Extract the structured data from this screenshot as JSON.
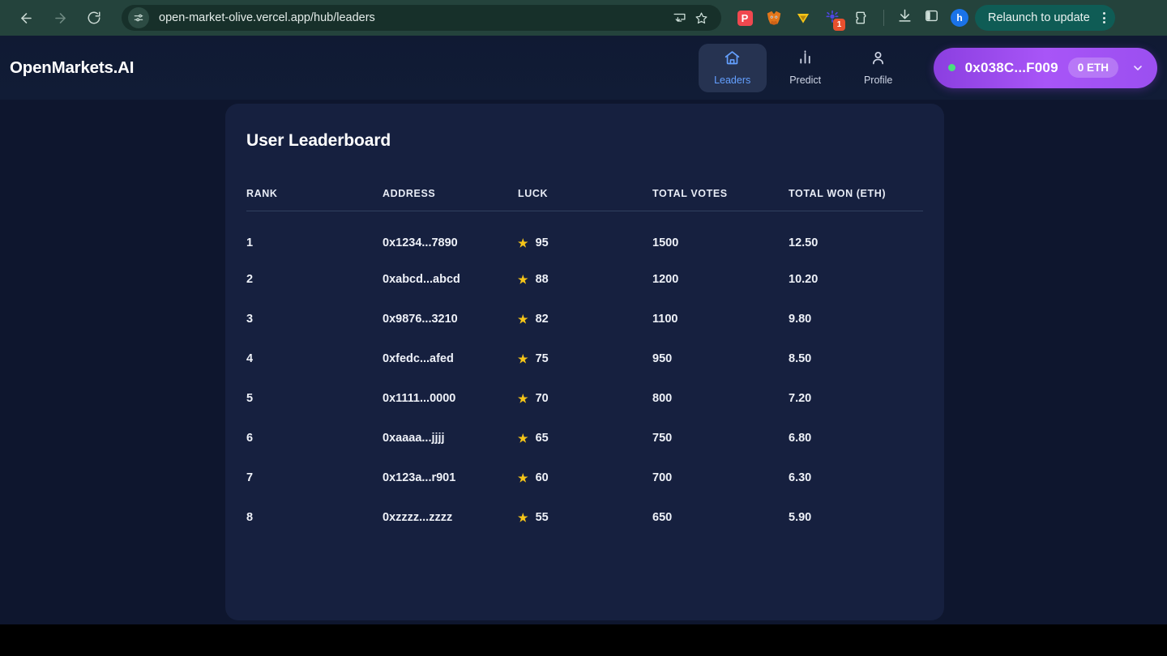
{
  "browser": {
    "back_icon": "back-arrow-icon",
    "forward_icon": "forward-arrow-icon",
    "reload_icon": "reload-icon",
    "site_info_icon": "site-settings-icon",
    "url": "open-market-olive.vercel.app/hub/leaders",
    "cast_icon": "cast-icon",
    "bookmark_icon": "star-outline-icon",
    "extensions": [
      {
        "name": "pocket-extension-icon",
        "label": "P"
      },
      {
        "name": "metamask-fox-icon",
        "label": "🦊"
      },
      {
        "name": "triangle-wallet-icon",
        "label": "▼"
      },
      {
        "name": "starburst-extension-icon",
        "badge": "1"
      },
      {
        "name": "extensions-puzzle-icon",
        "label": ""
      }
    ],
    "download_icon": "download-icon",
    "side_panel_icon": "side-panel-icon",
    "profile_initial": "h",
    "relaunch_label": "Relaunch to update",
    "menu_icon": "kebab-menu-icon"
  },
  "header": {
    "logo": "OpenMarkets.AI",
    "nav": [
      {
        "label": "Leaders",
        "icon": "home-icon",
        "active": true
      },
      {
        "label": "Predict",
        "icon": "bar-chart-icon",
        "active": false
      },
      {
        "label": "Profile",
        "icon": "person-icon",
        "active": false
      }
    ],
    "wallet": {
      "status": "connected",
      "address": "0x038C...F009",
      "balance": "0 ETH",
      "chevron_icon": "chevron-down-icon"
    }
  },
  "main": {
    "card_title": "User Leaderboard",
    "table": {
      "columns": [
        "RANK",
        "ADDRESS",
        "LUCK",
        "TOTAL VOTES",
        "TOTAL WON (ETH)"
      ],
      "rows": [
        {
          "rank": "1",
          "address": "0x1234...7890",
          "luck": "95",
          "votes": "1500",
          "won": "12.50"
        },
        {
          "rank": "2",
          "address": "0xabcd...abcd",
          "luck": "88",
          "votes": "1200",
          "won": "10.20"
        },
        {
          "rank": "3",
          "address": "0x9876...3210",
          "luck": "82",
          "votes": "1100",
          "won": "9.80"
        },
        {
          "rank": "4",
          "address": "0xfedc...afed",
          "luck": "75",
          "votes": "950",
          "won": "8.50"
        },
        {
          "rank": "5",
          "address": "0x1111...0000",
          "luck": "70",
          "votes": "800",
          "won": "7.20"
        },
        {
          "rank": "6",
          "address": "0xaaaa...jjjj",
          "luck": "65",
          "votes": "750",
          "won": "6.80"
        },
        {
          "rank": "7",
          "address": "0x123a...r901",
          "luck": "60",
          "votes": "700",
          "won": "6.30"
        },
        {
          "rank": "8",
          "address": "0xzzzz...zzzz",
          "luck": "55",
          "votes": "650",
          "won": "5.90"
        }
      ],
      "star_icon": "star-icon"
    }
  },
  "colors": {
    "browser_chrome": "#24433c",
    "page_bg": "#0e162e",
    "card_bg": "#16203f",
    "accent_blue": "#64a0ff",
    "wallet_purple": "#a855f7",
    "star_gold": "#f5c518",
    "status_green": "#4ade80"
  }
}
